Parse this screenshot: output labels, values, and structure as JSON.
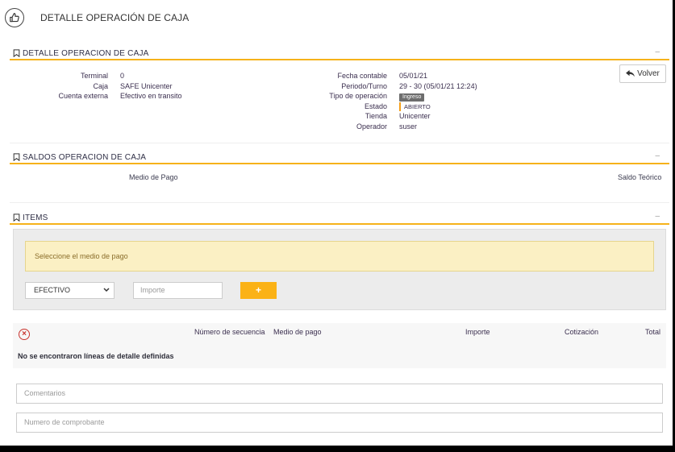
{
  "header": {
    "title": "DETALLE OPERACIÓN DE CAJA",
    "icon": "thumbs-up-icon"
  },
  "section_detalle": {
    "title": "DETALLE OPERACION DE CAJA",
    "collapse": "–",
    "left": [
      {
        "label": "Terminal",
        "value": "0"
      },
      {
        "label": "Caja",
        "value": "SAFE Unicenter"
      },
      {
        "label": "Cuenta externa",
        "value": "Efectivo en transito"
      }
    ],
    "right": {
      "fecha_contable": {
        "label": "Fecha contable",
        "value": "05/01/21"
      },
      "periodo_turno": {
        "label": "Periodo/Turno",
        "value": "29 - 30 (05/01/21 12:24)"
      },
      "tipo_operacion": {
        "label": "Tipo de operación",
        "value": "Ingreso"
      },
      "estado": {
        "label": "Estado",
        "value": "ABIERTO"
      },
      "tienda": {
        "label": "Tienda",
        "value": "Unicenter"
      },
      "operador": {
        "label": "Operador",
        "value": "suser"
      }
    },
    "volver_label": "Volver"
  },
  "section_saldos": {
    "title": "SALDOS OPERACION DE CAJA",
    "collapse": "–",
    "col_medio": "Medio de Pago",
    "col_saldo": "Saldo Teórico"
  },
  "section_items": {
    "title": "ITEMS",
    "collapse": "–",
    "warning": "Seleccione el medio de pago",
    "select_value": "EFECTIVO",
    "importe_placeholder": "Importe",
    "add_label": "+",
    "table": {
      "columns": [
        "Número de secuencia",
        "Medio de pago",
        "Importe",
        "Cotización",
        "Total"
      ],
      "empty_message": "No se encontraron líneas de detalle definidas"
    }
  },
  "comentarios_placeholder": "Comentarios",
  "comprobante_placeholder": "Numero de comprobante",
  "colors": {
    "accent": "#f6b21a",
    "warning_bg": "#fbf0c4",
    "danger": "#c9342e"
  }
}
